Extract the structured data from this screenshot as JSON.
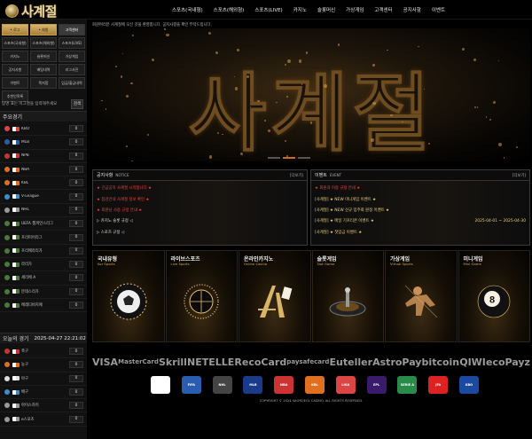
{
  "app": {
    "logo_text": "사계절"
  },
  "topnav": [
    "스포츠(국내형)",
    "스포츠(해외형)",
    "스포츠(LIVE)",
    "카지노",
    "슬롯머신",
    "가상게임",
    "고객센터",
    "공지사항",
    "이벤트"
  ],
  "sidebar": {
    "grid": [
      {
        "label": "• 로그",
        "state": "active"
      },
      {
        "label": "• 회원",
        "state": "active"
      },
      {
        "label": "고객센터",
        "state": "selected"
      },
      {
        "label": "스포츠(국내형)",
        "state": ""
      },
      {
        "label": "스포츠(해외형)",
        "state": ""
      },
      {
        "label": "스포츠(LIVE)",
        "state": ""
      },
      {
        "label": "카지노",
        "state": ""
      },
      {
        "label": "슬롯머신",
        "state": ""
      },
      {
        "label": "가상게임",
        "state": ""
      },
      {
        "label": "공지사항",
        "state": ""
      },
      {
        "label": "배팅내역",
        "state": ""
      },
      {
        "label": "리그사진",
        "state": ""
      },
      {
        "label": "이벤트",
        "state": ""
      },
      {
        "label": "쪽지함",
        "state": ""
      },
      {
        "label": "입금/출금내역",
        "state": ""
      },
      {
        "label": "추천인목록",
        "state": ""
      }
    ],
    "notice_text": "탑명 표는 이그명을 입력해주세요",
    "notice_button": "검색",
    "major_title": "주요경기",
    "leagues": [
      {
        "name": "KBO",
        "count": "0",
        "color": "#d44"
      },
      {
        "name": "MLB",
        "count": "0",
        "color": "#2a5db0"
      },
      {
        "name": "NPB",
        "count": "0",
        "color": "#c33"
      },
      {
        "name": "NBA",
        "count": "0",
        "color": "#e07020"
      },
      {
        "name": "KBL",
        "count": "0",
        "color": "#e07020"
      },
      {
        "name": "V-League",
        "count": "0",
        "color": "#3a8fd0"
      },
      {
        "name": "NHL",
        "count": "0",
        "color": "#999"
      },
      {
        "name": "UEFA 챔피언스리그",
        "count": "0",
        "color": "#4a7a3a"
      },
      {
        "name": "프리미어리그",
        "count": "0",
        "color": "#4a7a3a"
      },
      {
        "name": "프리메라리가",
        "count": "0",
        "color": "#4a7a3a"
      },
      {
        "name": "라리가",
        "count": "0",
        "color": "#4a7a3a"
      },
      {
        "name": "세리에 A",
        "count": "0",
        "color": "#4a7a3a"
      },
      {
        "name": "분데스리가",
        "count": "0",
        "color": "#4a7a3a"
      },
      {
        "name": "에레디비지에",
        "count": "0",
        "color": "#4a7a3a"
      }
    ],
    "today_title": "오늘의 경기",
    "today_time": "2025-04-27 22:21:02",
    "today": [
      {
        "name": "축구",
        "count": "0",
        "color": "#c33"
      },
      {
        "name": "농구",
        "count": "0",
        "color": "#e07020"
      },
      {
        "name": "야구",
        "count": "0",
        "color": "#ddd"
      },
      {
        "name": "배구",
        "count": "0",
        "color": "#3a8fd0"
      },
      {
        "name": "아이스하키",
        "count": "0",
        "color": "#999"
      },
      {
        "name": "e스포츠",
        "count": "0",
        "color": "#999"
      }
    ]
  },
  "marquee": "회원여러분 사계절에 오신 것을 환영합니다. 공지사항을 확인 부탁드립니다.",
  "hero": {
    "title": "사계절"
  },
  "notice": {
    "title": "공지사항",
    "sub": "NOTICE",
    "more": "[더보기]",
    "posts": [
      {
        "text": "★ 긴급공지 사계절 시작합니다 ★",
        "color": "#e44"
      },
      {
        "text": "★ 점검안내 사계절 정보 확인 ★",
        "color": "#e44"
      },
      {
        "text": "★ 회원님 사용 규정 안내 ★",
        "color": "#e44"
      },
      {
        "text": "▷ 카지노 슬롯 규정 ◁",
        "color": "#ddd"
      },
      {
        "text": "▷ 스포츠 규정 ◁",
        "color": "#ddd"
      }
    ]
  },
  "event": {
    "title": "이벤트",
    "sub": "EVENT",
    "more": "[더보기]",
    "posts": [
      {
        "text": "★ 회원과 이용 규정 안내 ★",
        "color": "#e44",
        "date": ""
      },
      {
        "text": "[사계절] ★ NEW 미니게임 이벤트 ★",
        "color": "#e8d27a",
        "date": ""
      },
      {
        "text": "[사계절] ★ NEW 신규 입주회 원정 이벤트 ★",
        "color": "#e8d27a",
        "date": ""
      },
      {
        "text": "[사계절] ★ 매일 기프티콘 이벤트 ★",
        "color": "#e8d27a",
        "date": "2025-04-01 ~ 2025-04-30"
      },
      {
        "text": "[사계절] ★ 첫입금 이벤트 ★",
        "color": "#e8d27a",
        "date": ""
      }
    ]
  },
  "cards": [
    {
      "title": "국내유형",
      "sub": "Kor Sports",
      "art": "ball"
    },
    {
      "title": "라이브스포츠",
      "sub": "Live Sports",
      "art": "ring"
    },
    {
      "title": "온라인카지노",
      "sub": "Online Casino",
      "art": "cards"
    },
    {
      "title": "슬롯게임",
      "sub": "Slot Game",
      "art": "roulette"
    },
    {
      "title": "가상게임",
      "sub": "Virtual Sports",
      "art": "fighter"
    },
    {
      "title": "미니게임",
      "sub": "Mini Game",
      "art": "eightball"
    }
  ],
  "payments": [
    "VISA",
    "MasterCard",
    "Skrill",
    "NETELLER",
    "ecoCard",
    "paysafecard",
    "Euteller",
    "AstroPay",
    "bitcoin",
    "QIWI",
    "ecoPayz"
  ],
  "partners": [
    "Jero",
    "FIFA",
    "NHL",
    "MLB",
    "NBA",
    "KBL",
    "LIGA",
    "EPL",
    "SERIE A",
    "JFA",
    "KBO"
  ],
  "copyright": "COPYRIGHT © 2024 SAGYEJEOL CASINO. ALL RIGHTS RESERVED."
}
